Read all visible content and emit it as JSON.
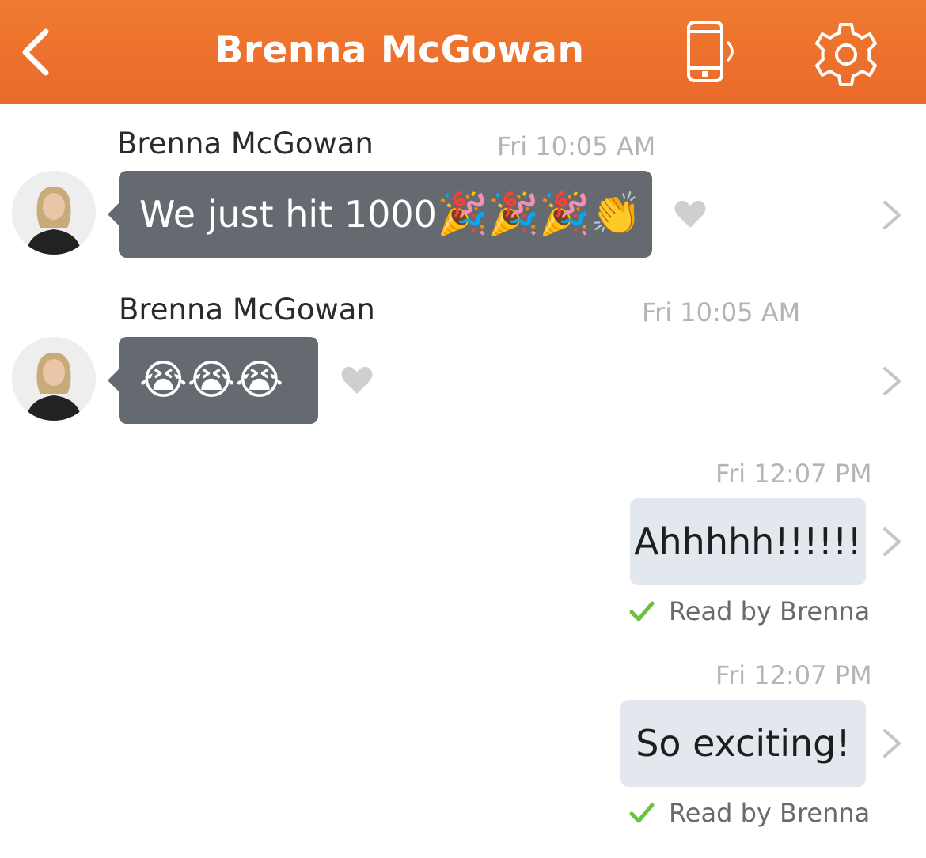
{
  "header": {
    "title": "Brenna McGowan",
    "accent_color": "#ee7230",
    "icons": [
      "back-chevron-icon",
      "phone-vibrate-icon",
      "gear-icon"
    ]
  },
  "messages": [
    {
      "sender": "Brenna McGowan",
      "time": "Fri 10:05 AM",
      "text": "We just hit 1000",
      "emoji": "🎉🎉🎉👏"
    },
    {
      "sender": "Brenna McGowan",
      "time": "Fri 10:05 AM",
      "emoji": "😭😭😭"
    },
    {
      "time": "Fri 12:07 PM",
      "text": "Ahhhhh!!!!!!",
      "status": "Read by Brenna"
    },
    {
      "time": "Fri 12:07 PM",
      "text": "So exciting!",
      "status": "Read by Brenna"
    }
  ],
  "colors": {
    "incoming_bubble": "#646a70",
    "outgoing_bubble": "#e3e8ee",
    "read_check": "#6ac23f"
  }
}
